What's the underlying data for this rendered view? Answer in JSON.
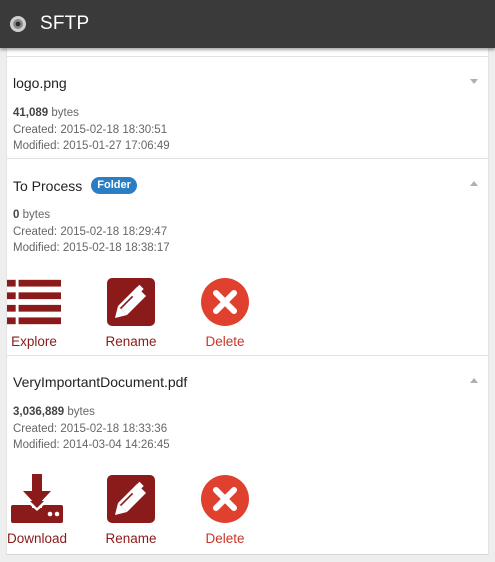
{
  "app": {
    "title": "SFTP",
    "icon": "disc-icon"
  },
  "files": [
    {
      "name": "logo.png",
      "badge": "",
      "size_value": "41,089",
      "size_unit": "bytes",
      "created_label": "Created:",
      "created": "2015-02-18 18:30:51",
      "modified_label": "Modified:",
      "modified": "2015-01-27 17:06:49",
      "expanded": false
    },
    {
      "name": "To Process",
      "badge": "Folder",
      "size_value": "0",
      "size_unit": "bytes",
      "created_label": "Created:",
      "created": "2015-02-18 18:29:47",
      "modified_label": "Modified:",
      "modified": "2015-02-18 18:38:17",
      "expanded": true,
      "actions": [
        {
          "label": "Explore",
          "icon": "list-icon"
        },
        {
          "label": "Rename",
          "icon": "pencil-icon"
        },
        {
          "label": "Delete",
          "icon": "delete-icon"
        }
      ]
    },
    {
      "name": "VeryImportantDocument.pdf",
      "badge": "",
      "size_value": "3,036,889",
      "size_unit": "bytes",
      "created_label": "Created:",
      "created": "2015-02-18 18:33:36",
      "modified_label": "Modified:",
      "modified": "2014-03-04 14:26:45",
      "expanded": true,
      "actions": [
        {
          "label": "Download",
          "icon": "download-icon"
        },
        {
          "label": "Rename",
          "icon": "pencil-icon"
        },
        {
          "label": "Delete",
          "icon": "delete-icon"
        }
      ]
    }
  ],
  "colors": {
    "titlebar": "#3a3a3a",
    "action_dark_red": "#8b1a1a",
    "delete_red": "#e0412f",
    "badge_blue": "#2a7fc4"
  }
}
